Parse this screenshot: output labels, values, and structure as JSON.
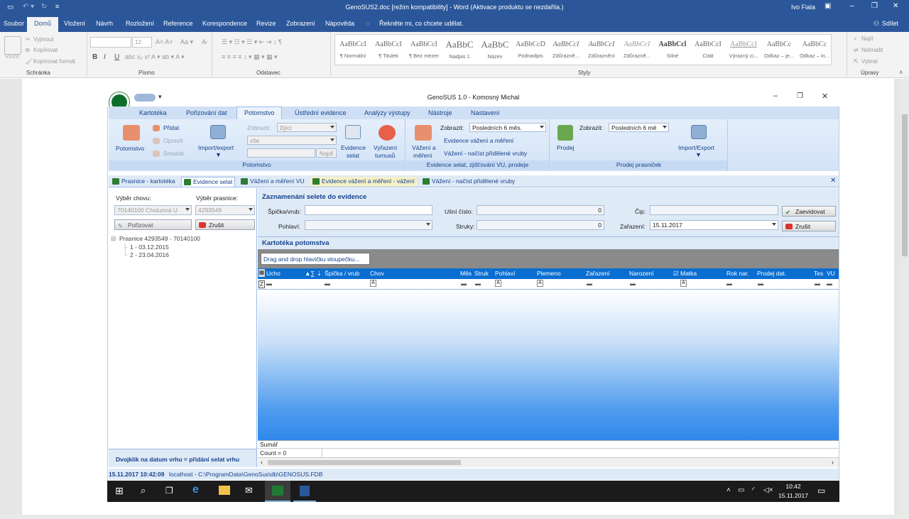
{
  "word": {
    "title": "GenoSUS2.doc [režim kompatibility] - Word (Aktivace produktu se nezdařila.)",
    "user": "Ivo Fiala",
    "menu": [
      "Soubor",
      "Domů",
      "Vložení",
      "Návrh",
      "Rozložení",
      "Reference",
      "Korespondence",
      "Revize",
      "Zobrazení",
      "Nápověda"
    ],
    "tell_me": "Řekněte mi, co chcete udělat.",
    "share": "Sdílet",
    "clipboard": {
      "paste": "Vložit",
      "cut": "Vyjmout",
      "copy": "Kopírovat",
      "format_painter": "Kopírovat formát"
    },
    "font": {
      "size": "12"
    },
    "styles": [
      {
        "preview": "AaBbCcI",
        "name": "¶ Normální"
      },
      {
        "preview": "AaBbCcI",
        "name": "¶ Titulek"
      },
      {
        "preview": "AaBbCcI",
        "name": "¶ Bez mezer"
      },
      {
        "preview": "AaBbC",
        "name": "Nadpis 1"
      },
      {
        "preview": "AaBbC",
        "name": "Název"
      },
      {
        "preview": "AaBbCcD",
        "name": "Podnadpis"
      },
      {
        "preview": "AaBbCcI",
        "name": "Zdůrazně..."
      },
      {
        "preview": "AaBbCcI",
        "name": "Zdůraznění"
      },
      {
        "preview": "AaBbCcI",
        "name": "Zdůrazně..."
      },
      {
        "preview": "AaBbCcl",
        "name": "Silné"
      },
      {
        "preview": "AaBbCcI",
        "name": "Citát"
      },
      {
        "preview": "AaBbCcI",
        "name": "Výrazný ci..."
      },
      {
        "preview": "AaBbCc",
        "name": "Odkaz – je..."
      },
      {
        "preview": "AaBbCc",
        "name": "Odkaz – in..."
      }
    ],
    "editing": {
      "find": "Najít",
      "replace": "Nahradit",
      "select": "Vybrat"
    },
    "groups": {
      "clipboard": "Schránka",
      "font": "Písmo",
      "paragraph": "Odstavec",
      "styles": "Styly",
      "editing": "Úpravy"
    }
  },
  "geno": {
    "title": "GenoSUS 1.0 - Komosný Michal",
    "tabs": [
      "Kartotéka",
      "Pořizování dat",
      "Potomstvo",
      "Ústřední evidence",
      "Analýzy výstupy",
      "Nástroje",
      "Nastavení"
    ],
    "ribbon": {
      "potomstvo": "Potomstvo",
      "add": "Přidat",
      "edit": "Opravit",
      "delete": "Smazat",
      "import_export": "Import/export",
      "show_label": "Zobrazit:",
      "show_value": "žijící",
      "all_value": "vše",
      "find": "Najdi",
      "evidence_selat_1": "Evidence",
      "evidence_selat_2": "selat",
      "vyrazeni_1": "Vyřazení",
      "vyrazeni_2": "turnusů",
      "group1": "Potomstvo",
      "vazeni_1": "Vážení a",
      "vazeni_2": "měření",
      "show2_label": "Zobrazit:",
      "show2_value": "Posledních 6 měs.",
      "evid_vazeni": "Evidence vážení a měření",
      "vazeni_nacist": "Vážení - načíst přidělené vruby",
      "group2": "Evidence selat, zjišťování VU, prodeje",
      "prodej": "Prodej",
      "show3_label": "Zobrazit:",
      "show3_value": "Posledních 6 mě",
      "import_export2": "Import/Export",
      "group3": "Prodej prasniček"
    },
    "doc_tabs": [
      "Prasnice - kartotéka",
      "Evidence selat",
      "Vážení a měření VU",
      "Evidence vážení a měření - vážení",
      "Vážení - načíst přidělené vruby"
    ],
    "left": {
      "vyber_chovu": "Výběr chovu:",
      "vyber_prasnice": "Výběr prasnice:",
      "chov_value": "70140100 Cholunná U",
      "prasnice_value": "4293549",
      "porizovat": "Pořizovat",
      "zrusit": "Zrušit",
      "tree_root": "Prasnice 4293549 - 70140100",
      "tree_items": [
        "1 - 03.12.2015",
        "2 - 23.04.2016"
      ],
      "hint": "Dvojklik na datum vrhu = přidání selat vrhu"
    },
    "form": {
      "title": "Zaznamenání selete do evidence",
      "spicka_label": "Špička/vrub:",
      "usni_label": "Ušní číslo:",
      "usni_value": "0",
      "cip_label": "Čip:",
      "zaevidovat": "Zaevidovat",
      "pohlavi_label": "Pohlaví:",
      "struky_label": "Struky:",
      "struky_value": "0",
      "zarazeni_label": "Zařazení:",
      "zarazeni_value": "15.11.2017",
      "zrusit": "Zrušit"
    },
    "grid": {
      "title": "Kartotéka potomstva",
      "drag_hint": "Drag and drop hlavičku sloupečku...",
      "columns": [
        "Ucho",
        "Špička / vrub",
        "Chov",
        "Měs",
        "Struk",
        "Pohlaví",
        "Plemeno",
        "Zařazení",
        "Narození",
        "Matka",
        "Rok nar.",
        "Prodej dat.",
        "Tes",
        "VU"
      ],
      "sum_label": "Sumář",
      "count": "Count = 0"
    },
    "status": {
      "datetime": "15.11.2017 10:42:09",
      "path": "localhost - C:\\ProgramData\\GenoSus\\db\\GENOSUS.FDB"
    },
    "taskbar": {
      "time": "10:42",
      "date": "15.11.2017"
    }
  }
}
